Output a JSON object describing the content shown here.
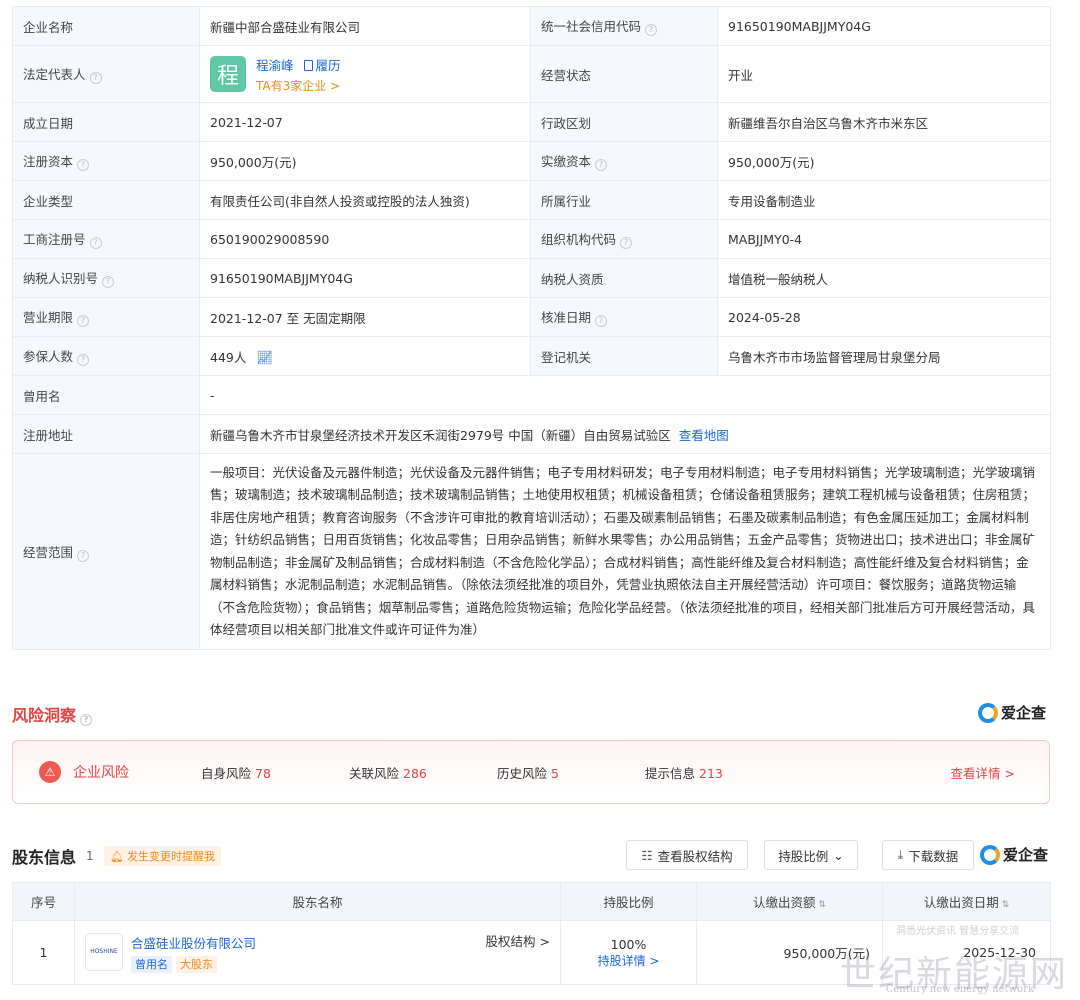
{
  "info": {
    "company_name_label": "企业名称",
    "company_name": "新疆中部合盛硅业有限公司",
    "credit_code_label": "统一社会信用代码",
    "credit_code": "91650190MABJJMY04G",
    "legal_rep_label": "法定代表人",
    "legal_rep_avatar": "程",
    "legal_rep_name": "程渝峰",
    "legal_rep_resume": "履历",
    "legal_rep_sub": "TA有3家企业 >",
    "status_label": "经营状态",
    "status": "开业",
    "founded_label": "成立日期",
    "founded": "2021-12-07",
    "region_label": "行政区划",
    "region": "新疆维吾尔自治区乌鲁木齐市米东区",
    "reg_capital_label": "注册资本",
    "reg_capital": "950,000万(元)",
    "paid_capital_label": "实缴资本",
    "paid_capital": "950,000万(元)",
    "type_label": "企业类型",
    "type": "有限责任公司(非自然人投资或控股的法人独资)",
    "industry_label": "所属行业",
    "industry": "专用设备制造业",
    "biz_reg_no_label": "工商注册号",
    "biz_reg_no": "650190029008590",
    "org_code_label": "组织机构代码",
    "org_code": "MABJJMY0-4",
    "taxpayer_id_label": "纳税人识别号",
    "taxpayer_id": "91650190MABJJMY04G",
    "taxpayer_qual_label": "纳税人资质",
    "taxpayer_qual": "增值税一般纳税人",
    "term_label": "营业期限",
    "term": "2021-12-07 至 无固定期限",
    "approval_date_label": "核准日期",
    "approval_date": "2024-05-28",
    "insured_label": "参保人数",
    "insured": "449人",
    "registrar_label": "登记机关",
    "registrar": "乌鲁木齐市市场监督管理局甘泉堡分局",
    "former_name_label": "曾用名",
    "former_name": "-",
    "address_label": "注册地址",
    "address": "新疆乌鲁木齐市甘泉堡经济技术开发区禾润街2979号 中国（新疆）自由贸易试验区",
    "address_map": "查看地图",
    "scope_label": "经营范围",
    "scope": "一般项目：光伏设备及元器件制造；光伏设备及元器件销售；电子专用材料研发；电子专用材料制造；电子专用材料销售；光学玻璃制造；光学玻璃销售；玻璃制造；技术玻璃制品制造；技术玻璃制品销售；土地使用权租赁；机械设备租赁；仓储设备租赁服务；建筑工程机械与设备租赁；住房租赁；非居住房地产租赁；教育咨询服务（不含涉许可审批的教育培训活动）；石墨及碳素制品销售；石墨及碳素制品制造；有色金属压延加工；金属材料制造；针纺织品销售；日用百货销售；化妆品零售；日用杂品销售；新鲜水果零售；办公用品销售；五金产品零售；货物进出口；技术进出口；非金属矿物制品制造；非金属矿及制品销售；合成材料制造（不含危险化学品）；合成材料销售；高性能纤维及复合材料制造；高性能纤维及复合材料销售；金属材料销售；水泥制品制造；水泥制品销售。（除依法须经批准的项目外，凭营业执照依法自主开展经营活动）许可项目：餐饮服务；道路货物运输（不含危险货物）；食品销售；烟草制品零售；道路危险货物运输；危险化学品经营。（依法须经批准的项目，经相关部门批准后方可开展经营活动，具体经营项目以相关部门批准文件或许可证件为准）"
  },
  "risk": {
    "title": "风险洞察",
    "brand": "爱企查",
    "box_title": "企业风险",
    "items": [
      {
        "label": "自身风险",
        "count": "78"
      },
      {
        "label": "关联风险",
        "count": "286"
      },
      {
        "label": "历史风险",
        "count": "5"
      },
      {
        "label": "提示信息",
        "count": "213"
      }
    ],
    "more": "查看详情 >"
  },
  "shareholders": {
    "title": "股东信息",
    "count": "1",
    "alert": "发生变更时提醒我",
    "btn_structure": "查看股权结构",
    "btn_ratio": "持股比例",
    "btn_download": "下载数据",
    "brand": "爱企查",
    "columns": [
      "序号",
      "股东名称",
      "持股比例",
      "认缴出资额",
      "认缴出资日期"
    ],
    "rows": [
      {
        "index": "1",
        "logo_text": "HOSHINE",
        "name": "合盛硅业股份有限公司",
        "tag_former": "曾用名",
        "tag_major": "大股东",
        "equity_link": "股权结构 >",
        "ratio": "100%",
        "ratio_link": "持股详情 >",
        "amount": "950,000万(元)",
        "date": "2025-12-30"
      }
    ]
  },
  "watermark": {
    "main": "世纪新能源网",
    "sub": "Century new energy network",
    "top": "洞悉光伏资讯 智慧分享交流"
  }
}
